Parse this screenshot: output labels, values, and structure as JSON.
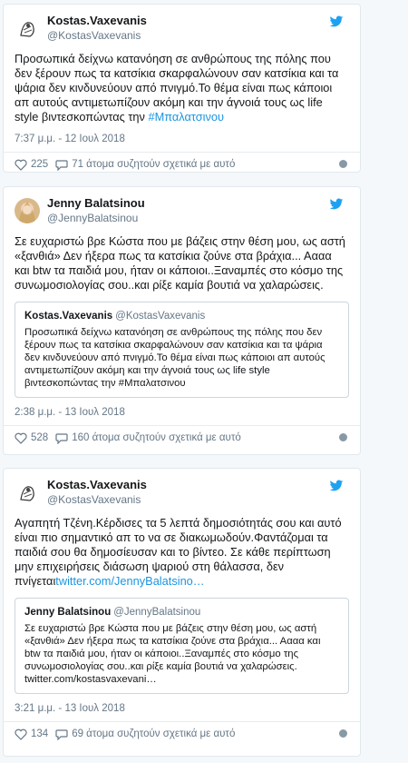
{
  "tweets": [
    {
      "display_name": "Kostas.Vaxevanis",
      "handle": "@KostasVaxevanis",
      "text": "Προσωπικά δείχνω κατανόηση σε ανθρώπους της πόλης που δεν ξέρουν πως τα κατσίκια σκαρφαλώνουν σαν κατσίκια και τα ψάρια δεν κινδυνεύουν από πνιγμό.Το θέμα είναι πως κάποιοι απ αυτούς αντιμετωπίζουν ακόμη και την άγνοιά τους ως life style βιντεσκοπώντας την ",
      "hashtag": "#Μπαλατσινου",
      "timestamp": "7:37 μ.μ. - 12 Ιουλ 2018",
      "likes": "225",
      "replies": "71 άτομα συζητούν σχετικά με αυτό"
    },
    {
      "display_name": "Jenny Balatsinou",
      "handle": "@JennyBalatsinou",
      "text": "Σε ευχαριστώ βρε Κώστα που με βάζεις στην θέση μου, ως αστή «ξανθιά» Δεν ήξερα πως τα κατσίκια ζούνε στα βράχια... Αααα και btw τα παιδιά μου, ήταν οι κάποιοι..Ξαναμπές  στο κόσμο της συνωμοσιολογίας σου..και ρίξε καμία βουτιά να χαλαρώσεις.",
      "quote": {
        "display_name": "Kostas.Vaxevanis",
        "handle": "@KostasVaxevanis",
        "text": "Προσωπικά δείχνω κατανόηση σε ανθρώπους της πόλης που δεν ξέρουν πως τα κατσίκια σκαρφαλώνουν σαν κατσίκια και τα ψάρια δεν κινδυνεύουν από πνιγμό.Το θέμα είναι πως κάποιοι απ αυτούς αντιμετωπίζουν ακόμη και την άγνοιά τους ως life style βιντεσκοπώντας την #Μπαλατσινου"
      },
      "timestamp": "2:38 μ.μ. - 13 Ιουλ 2018",
      "likes": "528",
      "replies": "160 άτομα συζητούν σχετικά με αυτό"
    },
    {
      "display_name": "Kostas.Vaxevanis",
      "handle": "@KostasVaxevanis",
      "text": "Αγαπητή Τζένη.Κέρδισες τα 5 λεπτά δημοσιότητάς σου και αυτό είναι πιο σημαντικό απ το να σε διακωμωδούν.Φαντάζομαι τα παιδιά σου θα δημοσίευσαν και το βίντεο. Σε κάθε περίπτωση μην επιχειρήσεις διάσωση ψαριού στη θάλασσα, δεν πνίγεται",
      "link": "twitter.com/JennyBalatsino…",
      "quote": {
        "display_name": "Jenny Balatsinou",
        "handle": "@JennyBalatsinou",
        "text": "Σε ευχαριστώ βρε Κώστα που με βάζεις στην θέση μου, ως αστή «ξανθιά» Δεν ήξερα πως τα κατσίκια ζούνε στα βράχια... Αααα και btw τα παιδιά μου, ήταν οι κάποιοι..Ξαναμπές  στο κόσμο της συνωμοσιολογίας σου..και ρίξε καμία βουτιά να χαλαρώσεις. twitter.com/kostasvaxevani…"
      },
      "timestamp": "3:21 μ.μ. - 13 Ιουλ 2018",
      "likes": "134",
      "replies": "69 άτομα συζητούν σχετικά με αυτό"
    }
  ],
  "colors": {
    "twitter_blue": "#1da1f2",
    "link": "#1b95e0",
    "secondary_text": "#657786"
  },
  "icons": [
    "twitter-bird-icon",
    "heart-icon",
    "reply-bubble-icon",
    "info-icon"
  ]
}
